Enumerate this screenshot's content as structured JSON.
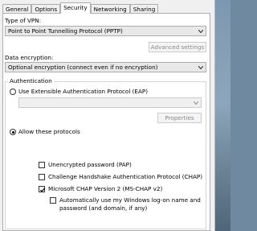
{
  "tabs": [
    "General",
    "Options",
    "Security",
    "Networking",
    "Sharing"
  ],
  "active_tab": "Security",
  "vpn_type": {
    "label": "Type of VPN:",
    "value": "Point to Point Tunnelling Protocol (PPTP)"
  },
  "advanced_settings_label": "Advanced settings",
  "data_encryption": {
    "label": "Data encryption:",
    "value": "Optional encryption (connect even if no encryption)"
  },
  "authentication": {
    "title": "Authentication",
    "eap_option": "Use Extensible Authentication Protocol (EAP)",
    "eap_selected": false,
    "eap_value": "",
    "properties_label": "Properties",
    "allow_option": "Allow these protocols",
    "allow_selected": true,
    "protocols": [
      {
        "label": "Unencrypted password (PAP)",
        "checked": false
      },
      {
        "label": "Challenge Handshake Authentication Protocol (CHAP)",
        "checked": false
      },
      {
        "label": "Microsoft CHAP Version 2 (MS-CHAP v2)",
        "checked": true
      }
    ],
    "auto_logon": {
      "line1": "Automatically use my Windows log-on name and",
      "line2": "password (and domain, if any)",
      "checked": false
    }
  }
}
